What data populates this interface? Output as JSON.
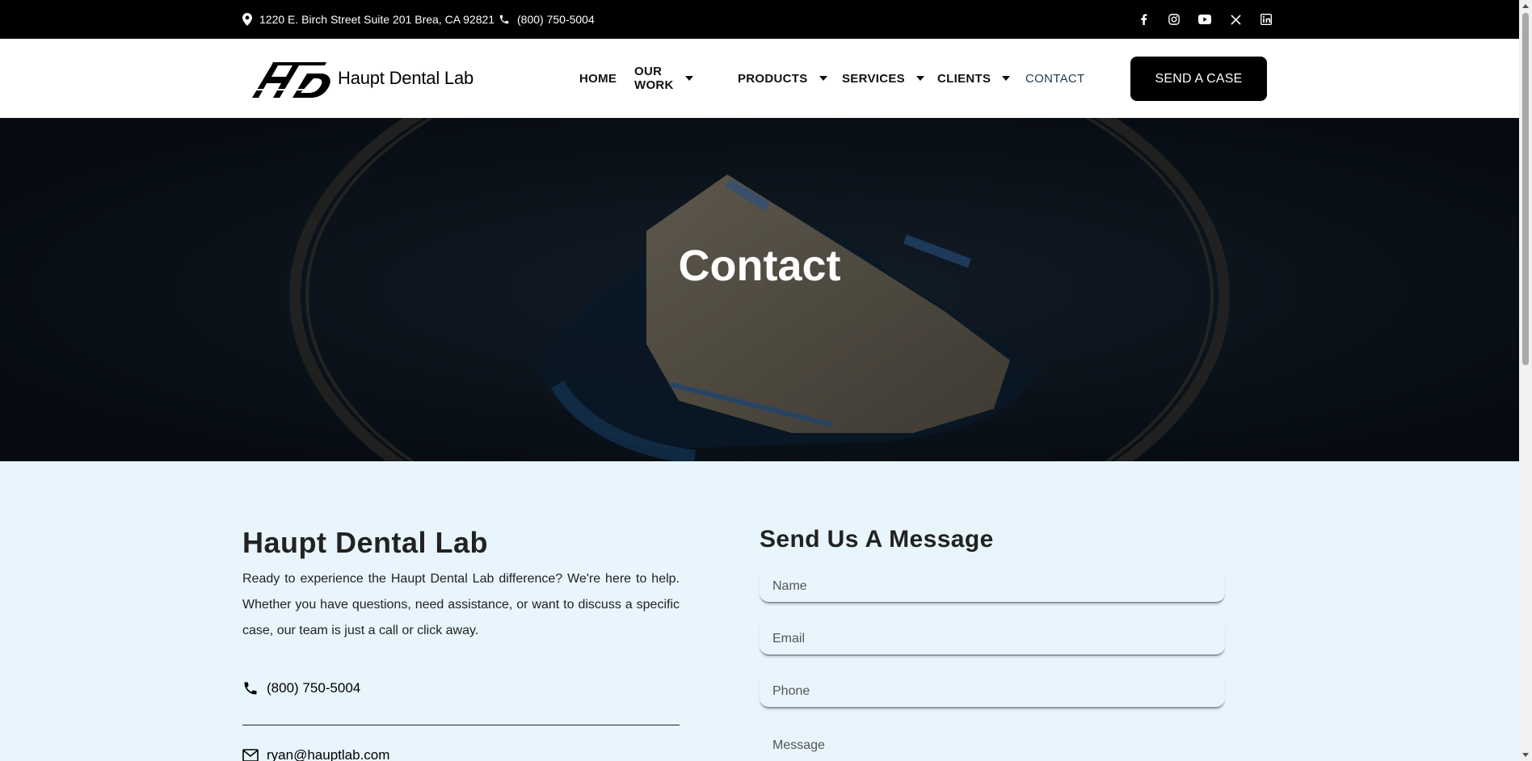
{
  "topbar": {
    "address": "1220 E. Birch Street Suite 201 Brea, CA 92821",
    "phone": "(800) 750-5004",
    "social": [
      "facebook-icon",
      "instagram-icon",
      "youtube-icon",
      "x-icon",
      "linkedin-icon"
    ]
  },
  "header": {
    "logo_text": "Haupt Dental Lab",
    "nav": [
      {
        "label": "HOME"
      },
      {
        "label": "OUR WORK"
      },
      {
        "label": "PRODUCTS"
      },
      {
        "label": "SERVICES"
      },
      {
        "label": "CLIENTS"
      },
      {
        "label": "CONTACT"
      }
    ],
    "cta_label": "SEND A CASE"
  },
  "hero": {
    "title": "Contact"
  },
  "info": {
    "title": "Haupt Dental Lab",
    "description": "Ready to experience the Haupt Dental Lab difference? We're here to help. Whether you have questions, need assistance, or want to discuss a specific case, our team is just a call or click away.",
    "phone": "(800) 750-5004",
    "email": "ryan@hauptlab.com"
  },
  "form": {
    "title": "Send Us A Message",
    "name_placeholder": "Name",
    "email_placeholder": "Email",
    "phone_placeholder": "Phone",
    "message_placeholder": "Message"
  },
  "colors": {
    "topbar_bg": "#000000",
    "content_bg": "#e8f5fc",
    "cta_bg": "#000000"
  }
}
